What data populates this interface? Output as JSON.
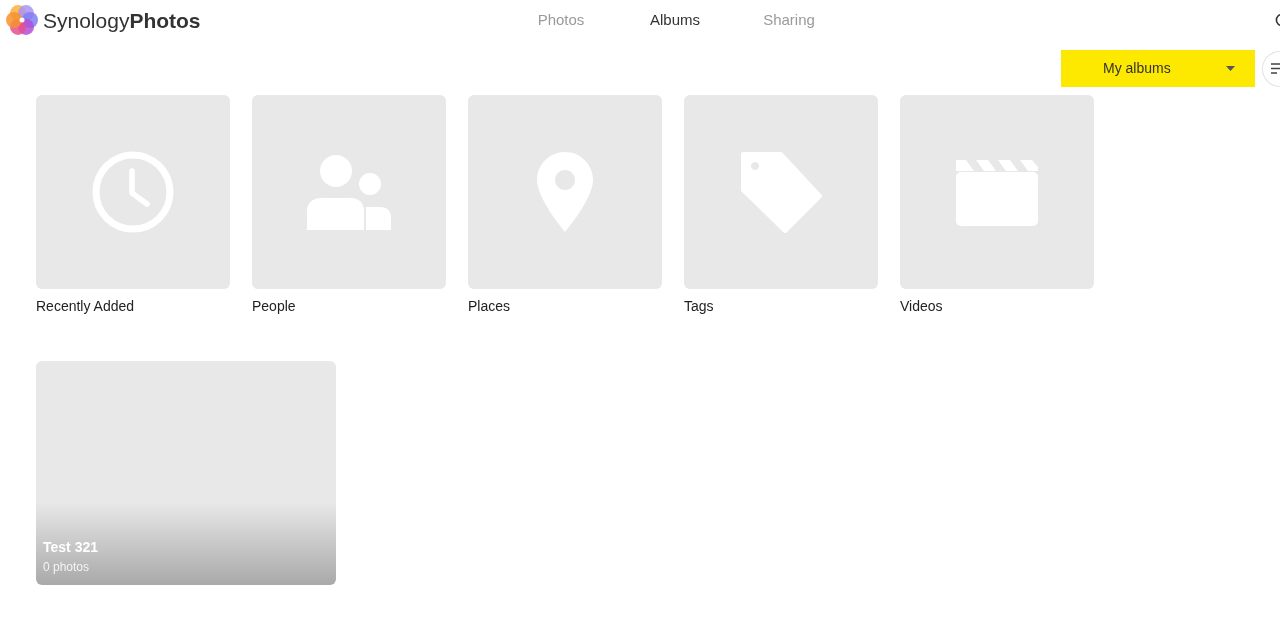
{
  "app": {
    "title": "Synology**Photos**"
  },
  "nav_tabs": [
    {
      "label": "Photos",
      "selected": false
    },
    {
      "label": "Albums",
      "selected": true
    },
    {
      "label": "Sharing",
      "selected": false
    }
  ],
  "toolbar": {
    "album_filter": "My albums"
  },
  "categories": [
    {
      "label": "Recently Added",
      "kind": "clock"
    },
    {
      "label": "People",
      "kind": "people"
    },
    {
      "label": "Places",
      "kind": "pin"
    },
    {
      "label": "Tags",
      "kind": "tag"
    },
    {
      "label": "Videos",
      "kind": "clapperboard"
    }
  ],
  "albums": [
    {
      "title": "Test 321",
      "count": "0 photos"
    }
  ]
}
